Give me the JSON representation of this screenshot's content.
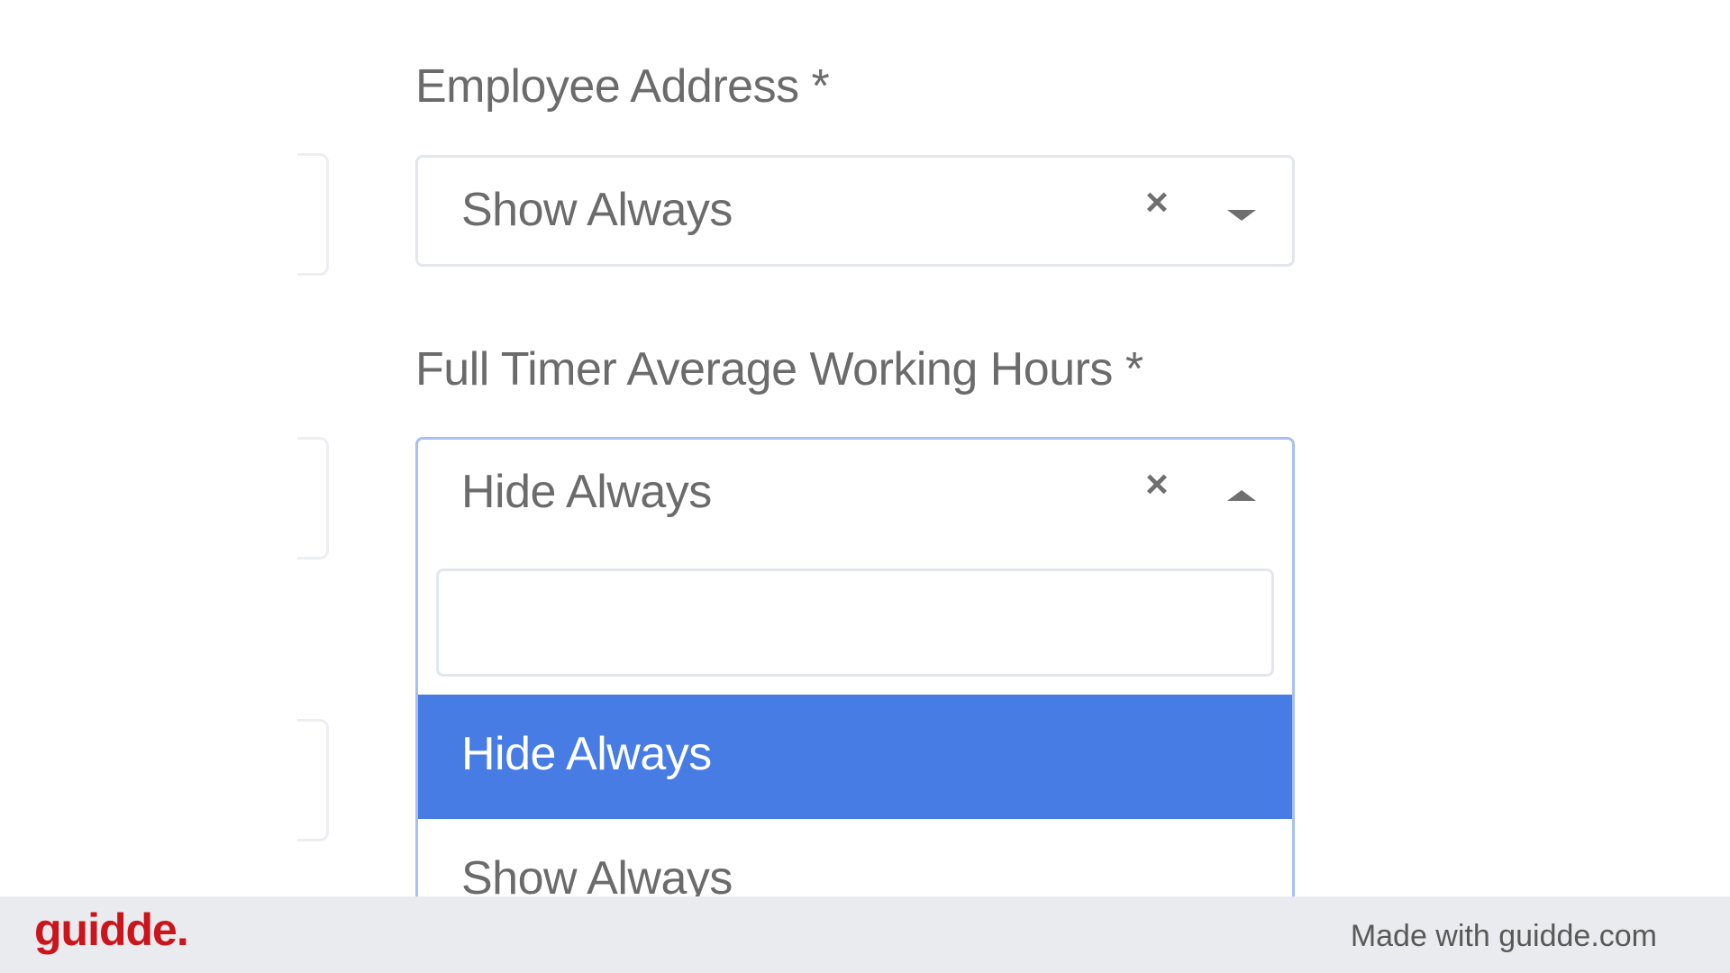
{
  "form": {
    "employee_address": {
      "label": "Employee Address *",
      "value": "Show Always",
      "clear_glyph": "×"
    },
    "full_timer_hours": {
      "label": "Full Timer Average Working Hours  *",
      "value": "Hide Always",
      "clear_glyph": "×",
      "search_placeholder": "",
      "options": [
        {
          "label": "Hide Always",
          "selected": true
        },
        {
          "label": "Show Always",
          "selected": false
        }
      ]
    }
  },
  "footer": {
    "logo": "guidde.",
    "made_with": "Made with guidde.com"
  },
  "colors": {
    "accent": "#477ce4",
    "brand": "#c9151b",
    "focus_border": "#a7c0f0"
  }
}
